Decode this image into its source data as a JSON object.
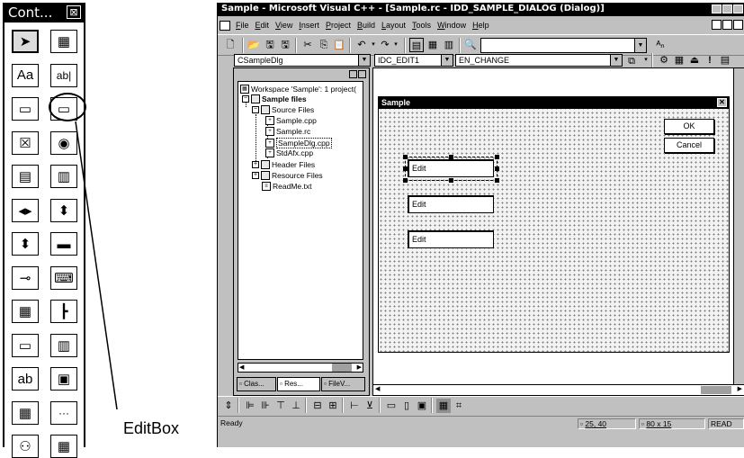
{
  "toolbox": {
    "title": "Cont...",
    "close_glyph": "⊠",
    "tools": [
      {
        "name": "pointer-icon",
        "glyph": "➤"
      },
      {
        "name": "picture-icon",
        "glyph": "▦"
      },
      {
        "name": "static-text-icon",
        "glyph": "Aa"
      },
      {
        "name": "edit-text-icon",
        "glyph": "ab|"
      },
      {
        "name": "group-box-icon",
        "glyph": "▭"
      },
      {
        "name": "editbox-icon",
        "glyph": "▭"
      },
      {
        "name": "check-box-icon",
        "glyph": "☒"
      },
      {
        "name": "radio-button-icon",
        "glyph": "◉"
      },
      {
        "name": "combo-box-icon",
        "glyph": "▤"
      },
      {
        "name": "list-box-icon",
        "glyph": "▥"
      },
      {
        "name": "horizontal-scroll-icon",
        "glyph": "◂▸"
      },
      {
        "name": "vertical-scroll-icon",
        "glyph": "⬍"
      },
      {
        "name": "spin-icon",
        "glyph": "⬍"
      },
      {
        "name": "progress-icon",
        "glyph": "▬"
      },
      {
        "name": "slider-icon",
        "glyph": "⊸"
      },
      {
        "name": "hotkey-icon",
        "glyph": "⌨"
      },
      {
        "name": "list-control-icon",
        "glyph": "▦"
      },
      {
        "name": "tree-control-icon",
        "glyph": "┣"
      },
      {
        "name": "tab-control-icon",
        "glyph": "▭"
      },
      {
        "name": "animate-icon",
        "glyph": "▥"
      },
      {
        "name": "rich-edit-icon",
        "glyph": "ab"
      },
      {
        "name": "date-time-icon",
        "glyph": "▣"
      },
      {
        "name": "month-calendar-icon",
        "glyph": "▦"
      },
      {
        "name": "ip-address-icon",
        "glyph": "···"
      },
      {
        "name": "custom-control-icon",
        "glyph": "⚇"
      },
      {
        "name": "extended-combo-icon",
        "glyph": "▦"
      }
    ]
  },
  "callout_label": "EditBox",
  "window": {
    "title": "Sample - Microsoft Visual C++ - [Sample.rc - IDD_SAMPLE_DIALOG (Dialog)]",
    "menu": [
      {
        "first": "F",
        "rest": "ile"
      },
      {
        "first": "E",
        "rest": "dit"
      },
      {
        "first": "V",
        "rest": "iew"
      },
      {
        "first": "I",
        "rest": "nsert"
      },
      {
        "first": "P",
        "rest": "roject"
      },
      {
        "first": "B",
        "rest": "uild"
      },
      {
        "first": "L",
        "rest": "ayout"
      },
      {
        "first": "T",
        "rest": "ools"
      },
      {
        "first": "W",
        "rest": "indow"
      },
      {
        "first": "H",
        "rest": "elp"
      }
    ],
    "class_combo": "CSampleDlg",
    "id_combo": "IDC_EDIT1",
    "message_combo": "EN_CHANGE"
  },
  "workspace": {
    "root": "Workspace 'Sample': 1 project(",
    "project": "Sample files",
    "source_folder": "Source Files",
    "files": [
      "Sample.cpp",
      "Sample.rc",
      "SampleDlg.cpp",
      "StdAfx.cpp"
    ],
    "header_folder": "Header Files",
    "resource_folder": "Resource Files",
    "readme": "ReadMe.txt",
    "tabs": [
      "Clas...",
      "Res...",
      "FileV..."
    ]
  },
  "dialog": {
    "title": "Sample",
    "ok_label": "OK",
    "cancel_label": "Cancel",
    "edits": [
      "Edit",
      "Edit",
      "Edit"
    ]
  },
  "status": {
    "ready": "Ready",
    "position": "25, 40",
    "size": "80 x 15",
    "mode": "READ"
  }
}
